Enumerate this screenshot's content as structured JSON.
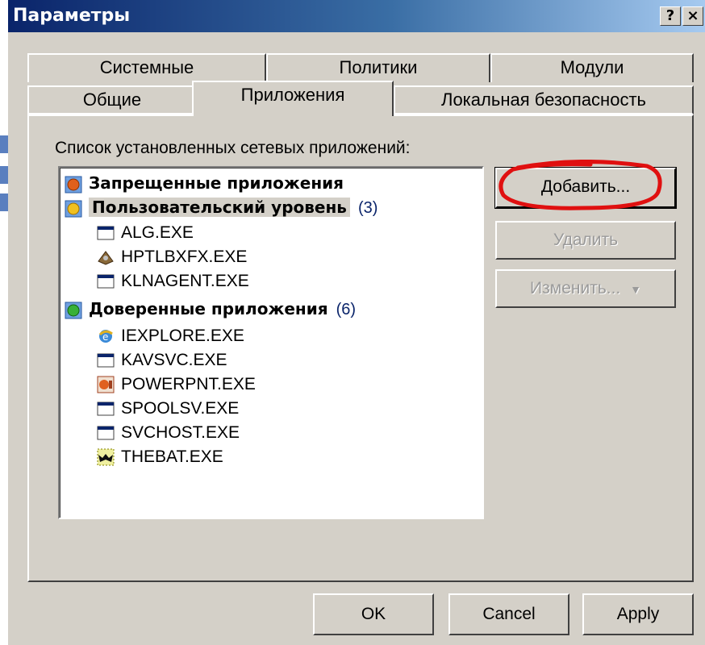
{
  "window": {
    "title": "Параметры",
    "help_button": "?",
    "close_button": "×"
  },
  "tabs": {
    "row_back": [
      "Системные",
      "Политики",
      "Модули"
    ],
    "row_front": [
      "Общие",
      "Приложения",
      "Локальная безопасность"
    ],
    "active": "Приложения"
  },
  "apps": {
    "list_label": "Список установленных сетевых приложений:",
    "groups": [
      {
        "label": "Запрещенные приложения",
        "count": "",
        "icon": "blocked-shield-icon",
        "color": "#e0601c",
        "items": []
      },
      {
        "label": "Пользовательский уровень",
        "count": "(3)",
        "icon": "user-level-shield-icon",
        "color": "#f0c020",
        "items": [
          {
            "name": "ALG.EXE",
            "icon": "window-app-icon"
          },
          {
            "name": "HPTLBXFX.EXE",
            "icon": "toolbox-app-icon"
          },
          {
            "name": "KLNAGENT.EXE",
            "icon": "window-app-icon"
          }
        ]
      },
      {
        "label": "Доверенные приложения",
        "count": "(6)",
        "icon": "trusted-shield-icon",
        "color": "#38b038",
        "items": [
          {
            "name": "IEXPLORE.EXE",
            "icon": "internet-explorer-icon"
          },
          {
            "name": "KAVSVC.EXE",
            "icon": "window-app-icon"
          },
          {
            "name": "POWERPNT.EXE",
            "icon": "powerpoint-icon"
          },
          {
            "name": "SPOOLSV.EXE",
            "icon": "window-app-icon"
          },
          {
            "name": "SVCHOST.EXE",
            "icon": "window-app-icon"
          },
          {
            "name": "THEBAT.EXE",
            "icon": "the-bat-icon"
          }
        ]
      }
    ],
    "add_button": "Добавить...",
    "remove_button": "Удалить",
    "edit_button": "Изменить..."
  },
  "footer": {
    "ok": "OK",
    "cancel": "Cancel",
    "apply": "Apply"
  },
  "colors": {
    "titlebar_start": "#0a246a",
    "titlebar_end": "#a6caf0",
    "dialog_face": "#d4d0c8",
    "highlight_circle": "#e01010"
  }
}
